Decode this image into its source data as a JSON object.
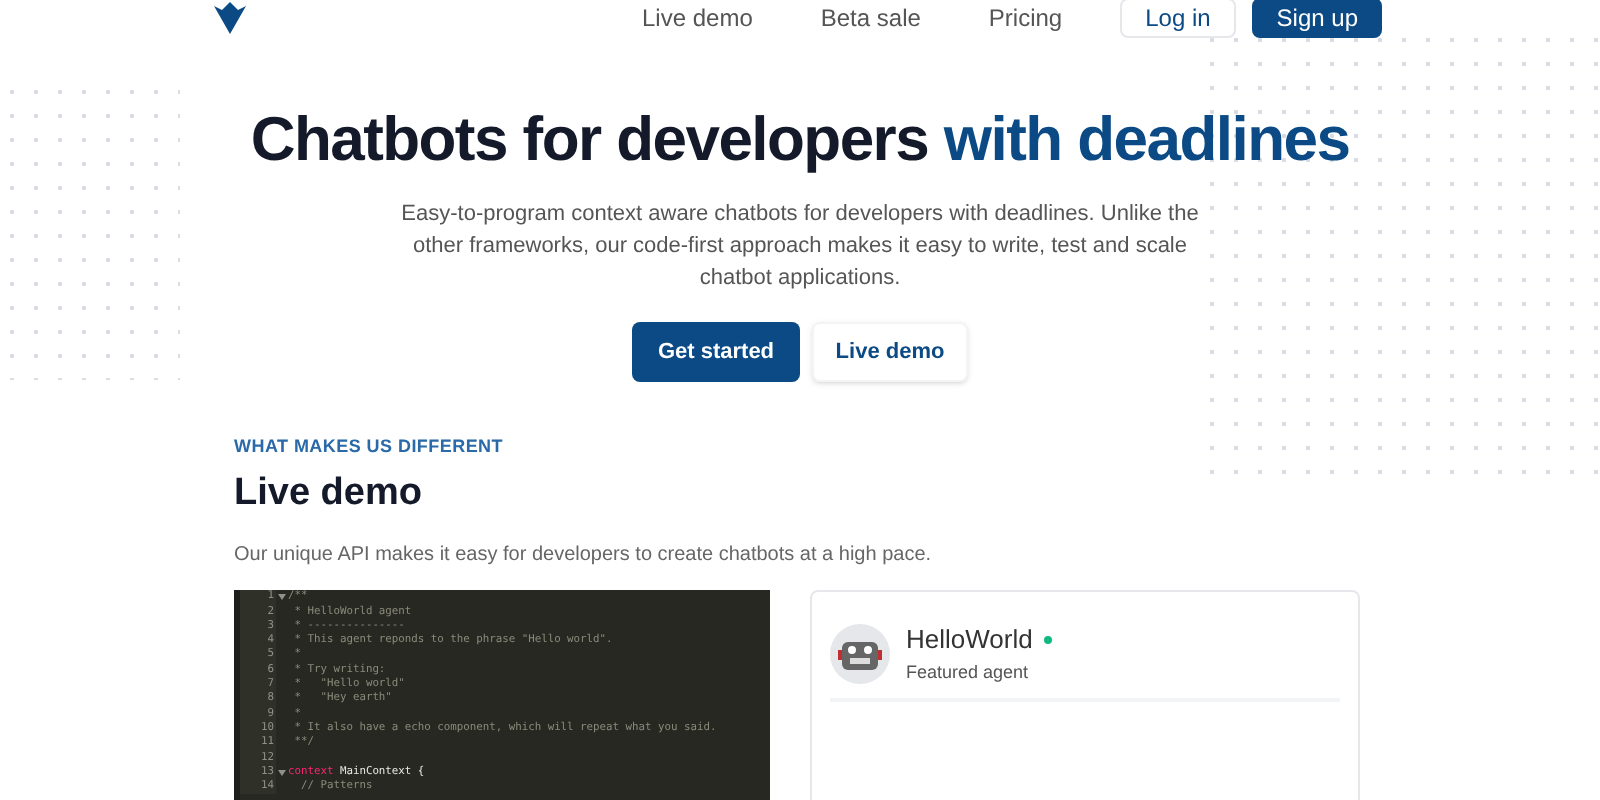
{
  "nav": {
    "links": [
      "Live demo",
      "Beta sale",
      "Pricing"
    ],
    "login": "Log in",
    "signup": "Sign up"
  },
  "hero": {
    "title": "Chatbots for developers",
    "title_accent": "with deadlines",
    "subtitle": "Easy-to-program context aware chatbots for developers with deadlines. Unlike the other frameworks, our code-first approach makes it easy to write, test and scale chatbot applications.",
    "primary": "Get started",
    "secondary": "Live demo"
  },
  "section": {
    "eyebrow": "WHAT MAKES US DIFFERENT",
    "title": "Live demo",
    "text": "Our unique API makes it easy for developers to create chatbots at a high pace."
  },
  "editor": {
    "lines": [
      {
        "num": "1",
        "fold": true,
        "segments": [
          {
            "kind": "comment",
            "text": "/**"
          }
        ]
      },
      {
        "num": "2",
        "fold": false,
        "segments": [
          {
            "kind": "comment",
            "text": " * HelloWorld agent"
          }
        ]
      },
      {
        "num": "3",
        "fold": false,
        "segments": [
          {
            "kind": "comment",
            "text": " * ---------------"
          }
        ]
      },
      {
        "num": "4",
        "fold": false,
        "segments": [
          {
            "kind": "comment",
            "text": " * This agent reponds to the phrase \"Hello world\"."
          }
        ]
      },
      {
        "num": "5",
        "fold": false,
        "segments": [
          {
            "kind": "comment",
            "text": " *"
          }
        ]
      },
      {
        "num": "6",
        "fold": false,
        "segments": [
          {
            "kind": "comment",
            "text": " * Try writing:"
          }
        ]
      },
      {
        "num": "7",
        "fold": false,
        "segments": [
          {
            "kind": "comment",
            "text": " *   \"Hello world\""
          }
        ]
      },
      {
        "num": "8",
        "fold": false,
        "segments": [
          {
            "kind": "comment",
            "text": " *   \"Hey earth\""
          }
        ]
      },
      {
        "num": "9",
        "fold": false,
        "segments": [
          {
            "kind": "comment",
            "text": " *"
          }
        ]
      },
      {
        "num": "10",
        "fold": false,
        "segments": [
          {
            "kind": "comment",
            "text": " * It also have a echo component, which will repeat what you said."
          }
        ]
      },
      {
        "num": "11",
        "fold": false,
        "segments": [
          {
            "kind": "comment",
            "text": " **/"
          }
        ]
      },
      {
        "num": "12",
        "fold": false
      },
      {
        "num": "13",
        "fold": true,
        "segments": [
          {
            "kind": "keyword",
            "text": "context"
          },
          {
            "kind": "code",
            "text": " MainContext {"
          }
        ]
      },
      {
        "num": "14",
        "fold": false,
        "segments": [
          {
            "kind": "comment",
            "text": "  // Patterns"
          }
        ]
      }
    ]
  },
  "agent": {
    "name": "HelloWorld",
    "online": true,
    "subtitle": "Featured agent"
  }
}
